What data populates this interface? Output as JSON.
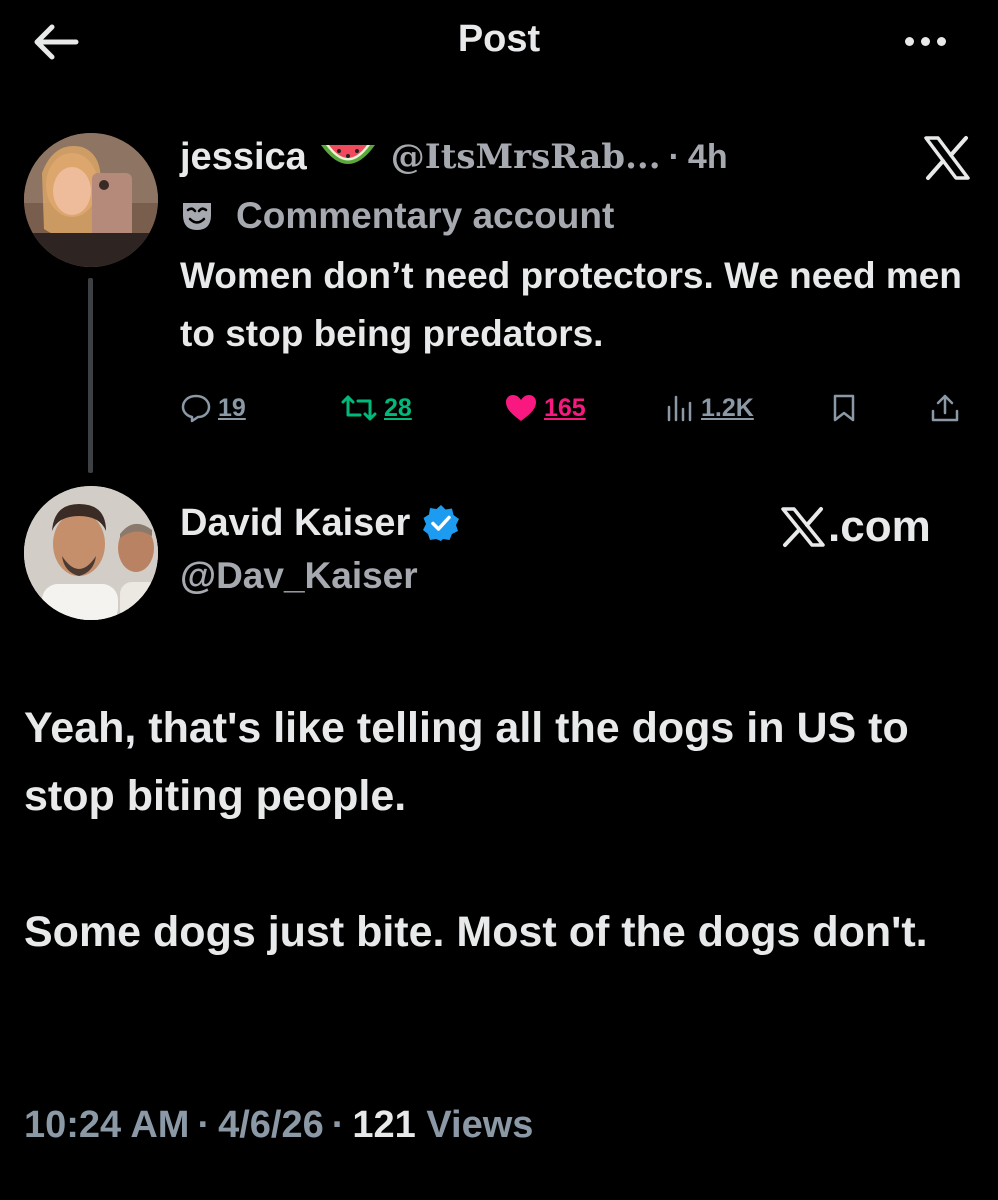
{
  "header": {
    "title": "Post"
  },
  "quoted_tweet": {
    "display_name": "jessica",
    "handle": "@ItsMrsRab...",
    "separator": "·",
    "time": "4h",
    "label": "Commentary account",
    "text": "Women don’t need protectors. We need men to stop being predators.",
    "stats": {
      "replies": "19",
      "reposts": "28",
      "likes": "165",
      "views": "1.2K"
    },
    "colors": {
      "repost": "#00ba7c",
      "like": "#f91880"
    }
  },
  "reply_tweet": {
    "display_name": "David Kaiser",
    "handle": "@Dav_Kaiser",
    "watermark": ".com",
    "paragraphs": [
      "Yeah, that's like telling all the dogs in US to stop biting people.",
      "Some dogs just bite. Most of the dogs don't."
    ],
    "meta": {
      "time": "10:24 AM",
      "date": "4/6/26",
      "separator": "·",
      "views_count": "121",
      "views_label": "Views"
    },
    "colors": {
      "verified": "#1d9bf0"
    }
  },
  "icons": [
    "back-arrow-icon",
    "more-icon",
    "x-logo-icon",
    "watermelon-emoji-icon",
    "mask-icon",
    "reply-icon",
    "repost-icon",
    "heart-icon",
    "views-icon",
    "bookmark-icon",
    "share-icon",
    "verified-badge-icon"
  ]
}
